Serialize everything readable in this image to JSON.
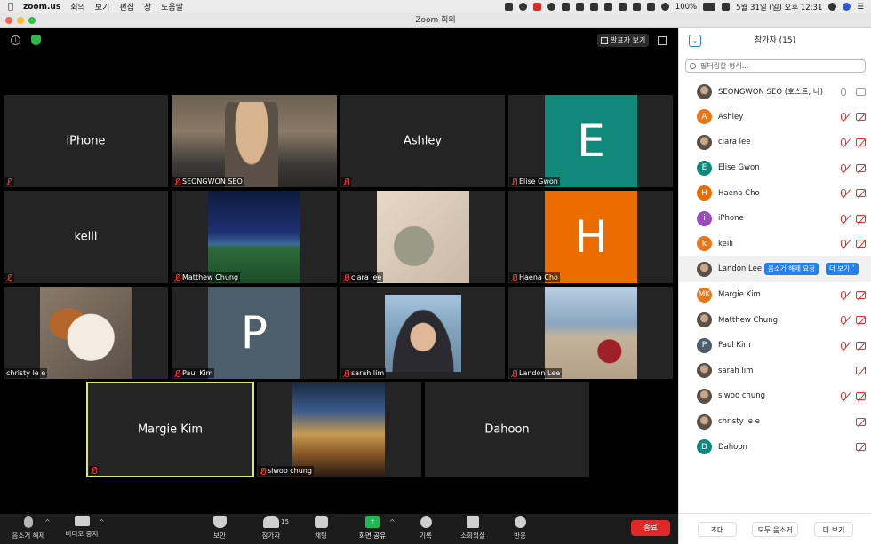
{
  "menubar": {
    "app": "zoom.us",
    "items": [
      "회의",
      "보기",
      "편집",
      "창",
      "도움말"
    ],
    "battery": "100%",
    "clock": "5월 31일 (일) 오후 12:31"
  },
  "window_title": "Zoom 회의",
  "speaker_view_label": "발표자 보기",
  "tiles": [
    {
      "name": "iPhone",
      "display": "text"
    },
    {
      "name": "SEONGWON SEO",
      "display": "video"
    },
    {
      "name": "Ashley",
      "display": "text"
    },
    {
      "name": "Elise Gwon",
      "display": "letter",
      "letter": "E",
      "color": "#10897a"
    },
    {
      "name": "keili",
      "display": "text"
    },
    {
      "name": "Matthew Chung",
      "display": "video"
    },
    {
      "name": "clara lee",
      "display": "video"
    },
    {
      "name": "Haena Cho",
      "display": "letter",
      "letter": "H",
      "color": "#ed6c00"
    },
    {
      "name": "christy le e",
      "display": "video"
    },
    {
      "name": "Paul Kim",
      "display": "letter",
      "letter": "P",
      "color": "#4c5e6a"
    },
    {
      "name": "sarah lim",
      "display": "video"
    },
    {
      "name": "Landon Lee",
      "display": "video"
    },
    {
      "name": "Margie Kim",
      "display": "text",
      "active": true
    },
    {
      "name": "siwoo chung",
      "display": "video"
    },
    {
      "name": "Dahoon",
      "display": "text"
    }
  ],
  "sidebar": {
    "title": "참가자 (15)",
    "search_placeholder": "필터링할 형식...",
    "participants": [
      {
        "name": "SEONGWON SEO (호스트, 나)",
        "avatar": "photo",
        "mic": "on",
        "cam": "on"
      },
      {
        "name": "Ashley",
        "avatar": "A",
        "color": "#e8761c",
        "mic": "muted",
        "cam": "off"
      },
      {
        "name": "clara lee",
        "avatar": "photo",
        "mic": "muted",
        "cam": "off"
      },
      {
        "name": "Elise Gwon",
        "avatar": "E",
        "color": "#10897a",
        "mic": "muted",
        "cam": "off"
      },
      {
        "name": "Haena Cho",
        "avatar": "H",
        "color": "#ed6c00",
        "mic": "muted",
        "cam": "off"
      },
      {
        "name": "iPhone",
        "avatar": "i",
        "color": "#9c4bbd",
        "mic": "muted",
        "cam": "off"
      },
      {
        "name": "keili",
        "avatar": "k",
        "color": "#e8761c",
        "mic": "muted",
        "cam": "off"
      },
      {
        "name": "Landon Lee",
        "avatar": "photo",
        "mic": "",
        "cam": "",
        "highlight": true
      },
      {
        "name": "Margie Kim",
        "avatar": "MK",
        "color": "#e8761c",
        "mic": "muted",
        "cam": "off"
      },
      {
        "name": "Matthew Chung",
        "avatar": "photo",
        "mic": "muted",
        "cam": "off"
      },
      {
        "name": "Paul Kim",
        "avatar": "P",
        "color": "#4c5e6a",
        "mic": "muted",
        "cam": "off"
      },
      {
        "name": "sarah lim",
        "avatar": "photo",
        "mic": "",
        "cam": "off"
      },
      {
        "name": "siwoo chung",
        "avatar": "photo",
        "mic": "muted",
        "cam": "off"
      },
      {
        "name": "christy le e",
        "avatar": "photo",
        "mic": "",
        "cam": "off"
      },
      {
        "name": "Dahoon",
        "avatar": "D",
        "color": "#10897a",
        "mic": "",
        "cam": "off"
      }
    ],
    "unmute_request_label": "음소거 해제 요청",
    "more_label": "더 보기",
    "footer": {
      "invite": "초대",
      "mute_all": "모두 음소거",
      "more": "더 보기"
    }
  },
  "toolbar": {
    "unmute": "음소거 해제",
    "stop_video": "비디오 중지",
    "security": "보안",
    "participants": "참가자",
    "participants_count": "15",
    "chat": "채팅",
    "share": "화면 공유",
    "record": "기록",
    "breakout": "소회의실",
    "reactions": "반응",
    "end": "종료"
  }
}
